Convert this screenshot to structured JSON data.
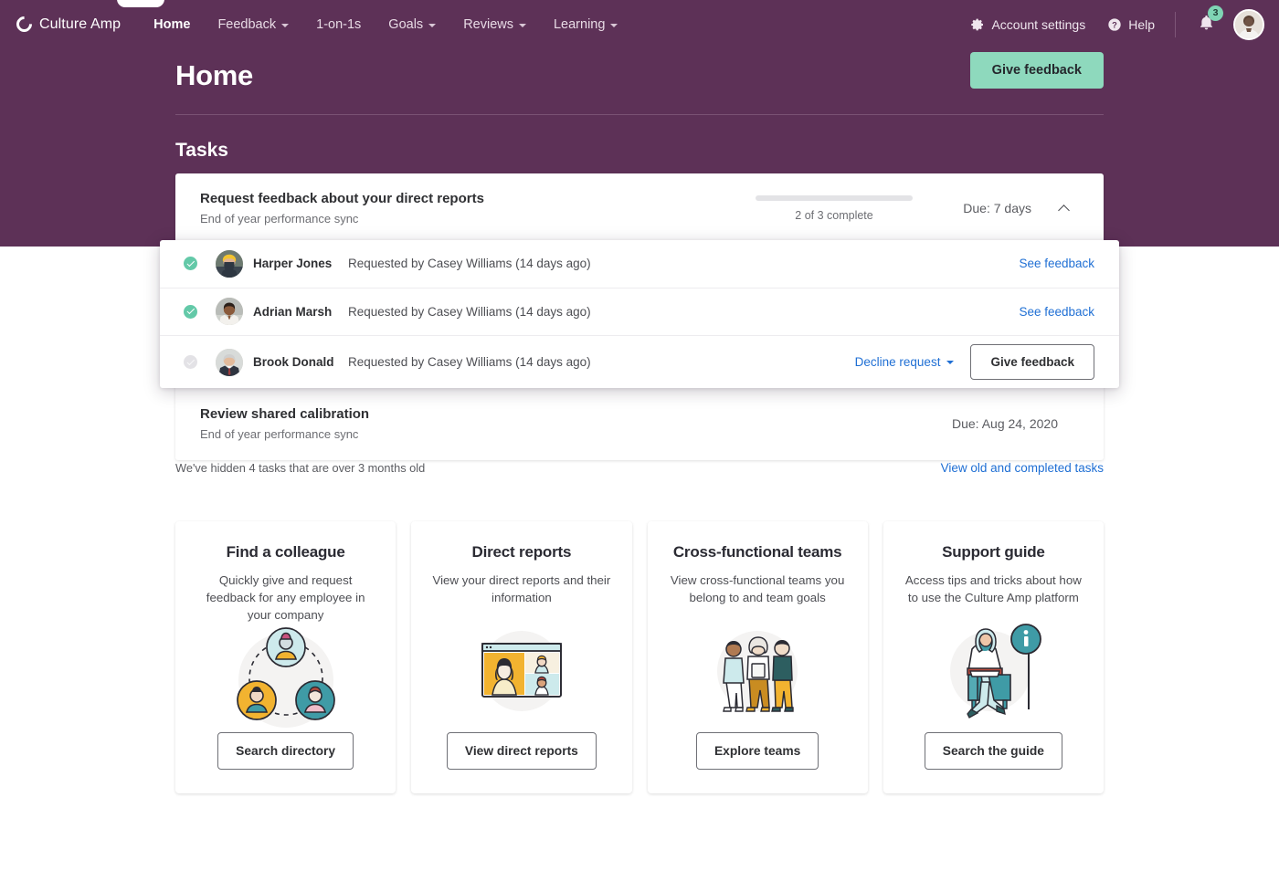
{
  "brand": {
    "name": "Culture Amp",
    "logo_icon": "culture-amp-c-icon"
  },
  "nav": {
    "items": [
      {
        "label": "Home",
        "has_caret": false,
        "active": true
      },
      {
        "label": "Feedback",
        "has_caret": true,
        "active": false
      },
      {
        "label": "1-on-1s",
        "has_caret": false,
        "active": false
      },
      {
        "label": "Goals",
        "has_caret": true,
        "active": false
      },
      {
        "label": "Reviews",
        "has_caret": true,
        "active": false
      },
      {
        "label": "Learning",
        "has_caret": true,
        "active": false
      }
    ],
    "account_settings": "Account settings",
    "account_settings_icon": "gear-icon",
    "help": "Help",
    "help_icon": "question-circle-icon",
    "bell_icon": "bell-icon",
    "notification_count": "3",
    "avatar_icon": "user-avatar"
  },
  "header": {
    "title": "Home",
    "give_feedback_label": "Give feedback",
    "tasks_heading": "Tasks"
  },
  "tasks": [
    {
      "title": "Request feedback about your direct reports",
      "subtitle": "End of year performance sync",
      "progress_label": "2 of 3 complete",
      "progress_percent": 0,
      "due": "Due: 7 days",
      "expanded": true,
      "collapse_icon": "chevron-up-icon"
    },
    {
      "title": "Review shared calibration",
      "subtitle": "End of year performance sync",
      "due": "Due: Aug 24, 2020"
    }
  ],
  "feedback_requests": [
    {
      "name": "Harper Jones",
      "meta": "Requested by Casey Williams (14 days ago)",
      "status": "done",
      "status_icon": "check-circle-icon",
      "action_link": "See feedback"
    },
    {
      "name": "Adrian Marsh",
      "meta": "Requested by Casey Williams (14 days ago)",
      "status": "done",
      "status_icon": "check-circle-icon",
      "action_link": "See feedback"
    },
    {
      "name": "Brook Donald",
      "meta": "Requested by Casey Williams (14 days ago)",
      "status": "pending",
      "status_icon": "check-circle-outline-icon",
      "decline_label": "Decline request",
      "decline_caret_icon": "chevron-down-icon",
      "give_feedback_label": "Give feedback"
    }
  ],
  "hidden_tasks": {
    "note": "We've hidden 4 tasks that are over 3 months old",
    "link": "View old and completed tasks"
  },
  "cards": [
    {
      "title": "Find a colleague",
      "desc": "Quickly give and request feedback for any employee in your company",
      "button": "Search directory",
      "art_icon": "three-people-network-illustration"
    },
    {
      "title": "Direct reports",
      "desc": "View your direct reports and their information",
      "button": "View direct reports",
      "art_icon": "video-call-window-illustration"
    },
    {
      "title": "Cross-functional teams",
      "desc": "View cross-functional teams you belong to and team goals",
      "button": "Explore teams",
      "art_icon": "three-standing-people-illustration"
    },
    {
      "title": "Support guide",
      "desc": "Access tips and tricks about how to use the Culture Amp platform",
      "button": "Search the guide",
      "art_icon": "person-reading-info-illustration"
    }
  ],
  "colors": {
    "brand_purple": "#5d3157",
    "accent_mint": "#8ed9bd",
    "link_blue": "#1f6fd4",
    "success_green": "#63c9a8"
  }
}
